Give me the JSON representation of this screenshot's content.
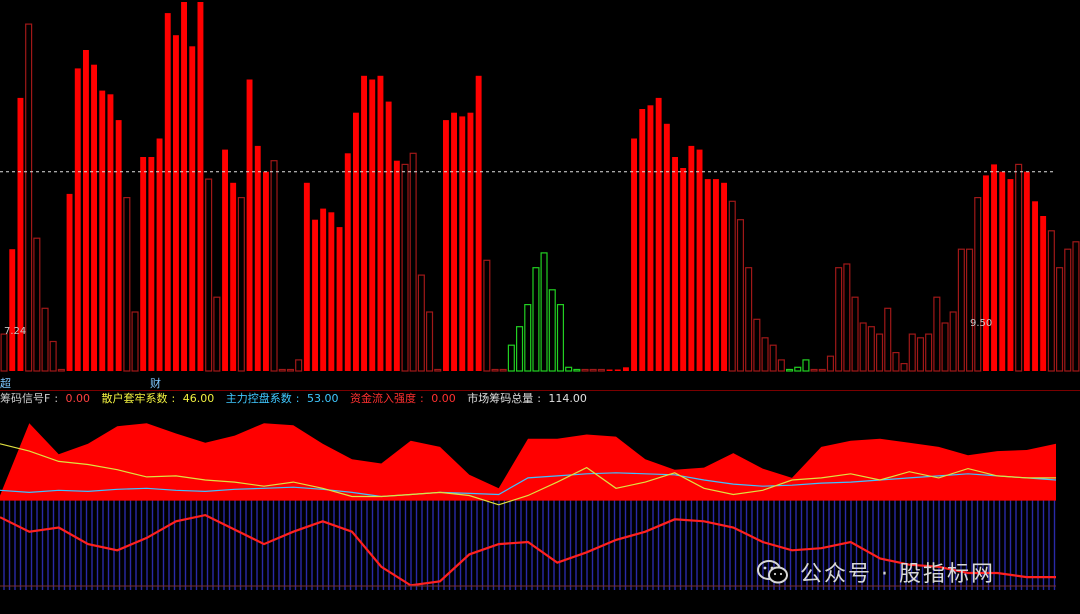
{
  "colors": {
    "bar_red_solid": "#ff0000",
    "bar_red_outline": "#a01818",
    "bar_green": "#22d022",
    "bar_white": "#d8d8d8",
    "dashed_line": "#e0e0e0",
    "panel_divider": "#7a0000",
    "area_red": "#ff0000",
    "blue_hist": "#2a2aa8",
    "yellow_line": "#e0e040",
    "red_line": "#ff2020",
    "cyan_line": "#40c0ff"
  },
  "markers": {
    "left": "超",
    "middle": "财"
  },
  "price_labels": {
    "left": "7.24",
    "right": "9.50"
  },
  "legend": [
    {
      "key": "legend_1",
      "label": "筹码信号F",
      "value": "0.00",
      "color": "#d0d0d0",
      "value_color": "#ff4040"
    },
    {
      "key": "legend_2",
      "label": "散户套牢系数",
      "value": "46.00",
      "color": "#f0f040",
      "value_color": "#f0f040"
    },
    {
      "key": "legend_3",
      "label": "主力控盘系数",
      "value": "53.00",
      "color": "#40c8ff",
      "value_color": "#40c8ff"
    },
    {
      "key": "legend_4",
      "label": "资金流入强度",
      "value": "0.00",
      "color": "#ff3030",
      "value_color": "#ff3030"
    },
    {
      "key": "legend_5",
      "label": "市场筹码总量",
      "value": "114.00",
      "color": "#e0e0e0",
      "value_color": "#e0e0e0"
    }
  ],
  "watermark": {
    "text": "公众号 · 股指标网"
  },
  "chart_data": [
    {
      "type": "bar",
      "panel": "top",
      "x": [
        1,
        2,
        3,
        4,
        5,
        6,
        7,
        8,
        9,
        10,
        11,
        12,
        13,
        14,
        15,
        16,
        17,
        18,
        19,
        20,
        21,
        22,
        23,
        24,
        25,
        26,
        27,
        28,
        29,
        30,
        31,
        32,
        33,
        34,
        35,
        36,
        37,
        38,
        39,
        40,
        41,
        42,
        43,
        44,
        45,
        46,
        47,
        48,
        49,
        50,
        51,
        52,
        53,
        54,
        55,
        56,
        57,
        58,
        59,
        60,
        61,
        62,
        63,
        64,
        65,
        66,
        67,
        68,
        69,
        70,
        71,
        72,
        73,
        74,
        75,
        76,
        77,
        78,
        79,
        80,
        81,
        82,
        83,
        84,
        85,
        86,
        87,
        88,
        89,
        90,
        91,
        92,
        93,
        94,
        95,
        96,
        97,
        98,
        99,
        100,
        101,
        102,
        103,
        104,
        105,
        106,
        107,
        108,
        109,
        110,
        111,
        112,
        113,
        114,
        115,
        116,
        117,
        118,
        119,
        120,
        121,
        122,
        123,
        124,
        125,
        126,
        127,
        128,
        129,
        130,
        131,
        132
      ],
      "values": [
        10,
        33,
        74,
        94,
        36,
        17,
        8,
        0,
        48,
        82,
        87,
        83,
        76,
        75,
        68,
        47,
        16,
        58,
        58,
        63,
        97,
        91,
        100,
        88,
        100,
        52,
        20,
        60,
        51,
        47,
        79,
        61,
        54,
        57,
        0,
        0,
        3,
        51,
        41,
        44,
        43,
        39,
        59,
        70,
        80,
        79,
        80,
        73,
        57,
        56,
        59,
        26,
        16,
        0,
        68,
        70,
        69,
        70,
        80,
        30,
        0,
        0,
        7,
        12,
        18,
        28,
        32,
        22,
        18,
        1,
        0,
        0,
        0,
        0,
        0,
        0,
        1,
        63,
        71,
        72,
        74,
        67,
        58,
        55,
        61,
        60,
        52,
        52,
        51,
        46,
        41,
        28,
        14,
        9,
        7,
        3,
        0,
        1,
        3,
        0,
        0,
        4,
        28,
        29,
        20,
        13,
        12,
        10,
        17,
        5,
        2,
        10,
        9,
        10,
        20,
        13,
        16,
        33,
        33,
        47,
        53,
        56,
        54,
        52,
        56,
        54,
        46,
        42,
        38,
        28,
        33,
        35
      ],
      "style": [
        "o",
        "s",
        "s",
        "o",
        "o",
        "o",
        "o",
        "o",
        "s",
        "s",
        "s",
        "s",
        "s",
        "s",
        "s",
        "o",
        "o",
        "s",
        "s",
        "s",
        "s",
        "s",
        "s",
        "s",
        "s",
        "o",
        "o",
        "s",
        "s",
        "o",
        "s",
        "s",
        "s",
        "o",
        "o",
        "o",
        "o",
        "s",
        "s",
        "s",
        "s",
        "s",
        "s",
        "s",
        "s",
        "s",
        "s",
        "s",
        "s",
        "o",
        "o",
        "o",
        "o",
        "o",
        "s",
        "s",
        "s",
        "s",
        "s",
        "o",
        "o",
        "o",
        "g",
        "g",
        "g",
        "g",
        "g",
        "g",
        "g",
        "g",
        "g",
        "o",
        "o",
        "o",
        "s",
        "s",
        "s",
        "s",
        "s",
        "s",
        "s",
        "s",
        "s",
        "s",
        "s",
        "s",
        "s",
        "s",
        "s",
        "o",
        "o",
        "o",
        "o",
        "o",
        "o",
        "o",
        "g",
        "g",
        "g",
        "o",
        "o",
        "o",
        "o",
        "o",
        "o",
        "o",
        "o",
        "o",
        "o",
        "o",
        "o",
        "o",
        "o",
        "o",
        "o",
        "o",
        "o",
        "o",
        "o",
        "o",
        "s",
        "s",
        "s",
        "s",
        "o",
        "s",
        "s",
        "s",
        "o",
        "o",
        "o",
        "o"
      ],
      "ylim": [
        0,
        100
      ],
      "reference_line": 54
    },
    {
      "type": "area",
      "panel": "bottom",
      "series": [
        {
          "key": "red_area_top",
          "values": [
            5,
            75,
            45,
            55,
            72,
            75,
            65,
            56,
            63,
            75,
            73,
            55,
            40,
            36,
            58,
            52,
            25,
            12,
            60,
            60,
            64,
            62,
            40,
            30,
            32,
            46,
            31,
            22,
            52,
            58,
            60,
            56,
            52,
            44,
            48,
            49,
            55
          ]
        },
        {
          "key": "yellow_line",
          "values": [
            55,
            48,
            38,
            35,
            30,
            23,
            24,
            20,
            18,
            14,
            18,
            12,
            4,
            4,
            6,
            8,
            5,
            -4,
            5,
            18,
            32,
            12,
            18,
            27,
            12,
            6,
            10,
            20,
            22,
            26,
            20,
            28,
            22,
            31,
            24,
            22,
            22
          ]
        },
        {
          "key": "red_line",
          "values": [
            -16,
            -30,
            -26,
            -42,
            -48,
            -36,
            -20,
            -14,
            -28,
            -42,
            -30,
            -20,
            -30,
            -64,
            -82,
            -78,
            -52,
            -42,
            -40,
            -60,
            -50,
            -38,
            -30,
            -18,
            -20,
            -26,
            -40,
            -48,
            -46,
            -40,
            -56,
            -62,
            -64,
            -70,
            -70,
            -74,
            -74
          ]
        },
        {
          "key": "cyan_line",
          "values": [
            10,
            8,
            10,
            9,
            11,
            12,
            10,
            9,
            11,
            12,
            13,
            11,
            8,
            4,
            6,
            8,
            7,
            6,
            22,
            24,
            26,
            27,
            26,
            25,
            20,
            16,
            14,
            15,
            17,
            18,
            20,
            22,
            24,
            26,
            24,
            22,
            20
          ]
        }
      ],
      "ylim": [
        -100,
        80
      ]
    }
  ]
}
